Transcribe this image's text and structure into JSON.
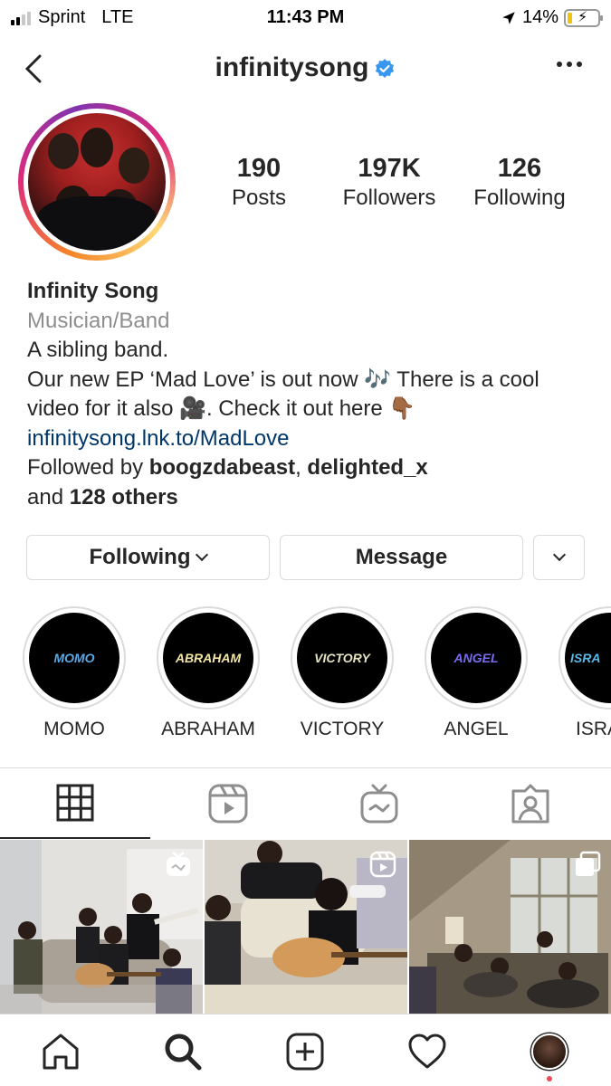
{
  "status_bar": {
    "carrier": "Sprint",
    "network": "LTE",
    "time": "11:43 PM",
    "battery": "14%",
    "battery_level": 0.14,
    "signal_bars_filled": 2
  },
  "header": {
    "username": "infinitysong",
    "verified": true,
    "back_icon": "chevron-left-icon",
    "more_icon": "ellipsis-icon"
  },
  "stats": {
    "posts": {
      "value": "190",
      "label": "Posts"
    },
    "followers": {
      "value": "197K",
      "label": "Followers"
    },
    "following": {
      "value": "126",
      "label": "Following"
    }
  },
  "bio": {
    "name": "Infinity Song",
    "category": "Musician/Band",
    "line1": "A sibling band.",
    "line2": "Our new EP ‘Mad Love’ is out now 🎶 There is a cool",
    "line3": "video for it also 🎥. Check it out here 👇🏾",
    "link": "infinitysong.lnk.to/MadLove",
    "followed_by_prefix": "Followed by ",
    "followed_by_1": "boogzdabeast",
    "followed_by_sep": ", ",
    "followed_by_2": "delighted_x",
    "followed_by_and": "and ",
    "followed_by_others": "128 others"
  },
  "buttons": {
    "following": "Following",
    "message": "Message"
  },
  "highlights": [
    {
      "title": "MOMO",
      "cover_text": "MOMO",
      "color": "#5aa9e6"
    },
    {
      "title": "ABRAHAM",
      "cover_text": "ABRAHAM",
      "color": "#f3e6a4"
    },
    {
      "title": "VICTORY",
      "cover_text": "VICTORY",
      "color": "#e6e3c0"
    },
    {
      "title": "ANGEL",
      "cover_text": "ANGEL",
      "color": "#7a6cf0"
    },
    {
      "title": "ISRA",
      "cover_text": "ISRA",
      "color": "#5ab8e6"
    }
  ],
  "tabs": [
    "grid-icon",
    "reels-icon",
    "igtv-icon",
    "tagged-icon"
  ],
  "posts": [
    {
      "type": "igtv",
      "badge": "igtv-icon"
    },
    {
      "type": "reel",
      "badge": "reels-icon"
    },
    {
      "type": "carousel",
      "badge": "carousel-icon"
    }
  ],
  "bottom_nav": [
    "home-icon",
    "search-icon",
    "new-post-icon",
    "activity-icon",
    "profile-avatar"
  ],
  "colors": {
    "link": "#00376b",
    "verified": "#3897f0",
    "notification_dot": "#ed4956",
    "border": "#dbdbdb"
  }
}
